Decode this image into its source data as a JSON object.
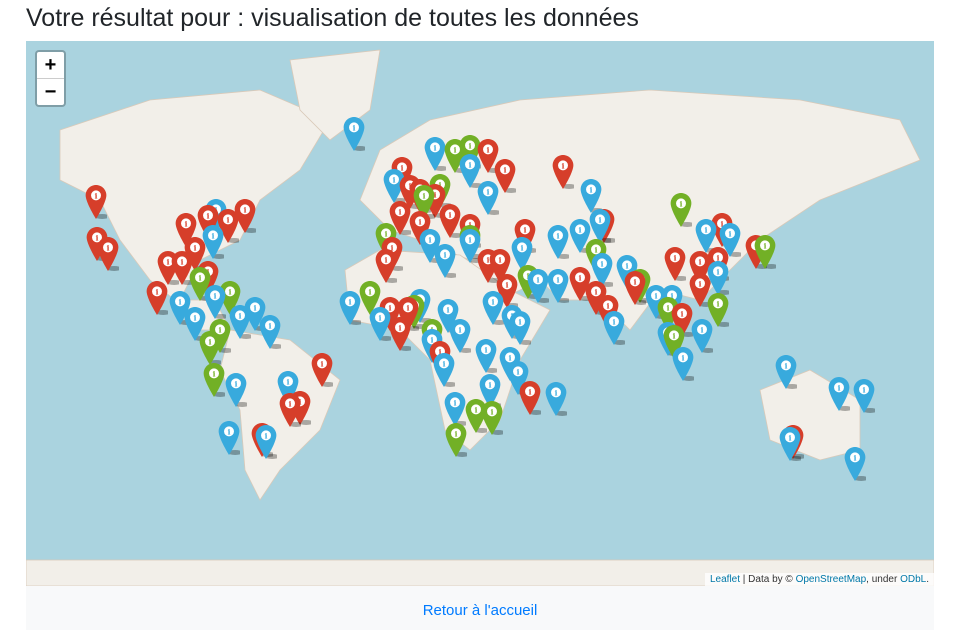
{
  "title": "Votre résultat pour : visualisation de toutes les données",
  "map": {
    "zoom_in": "+",
    "zoom_out": "−",
    "attribution": {
      "leaflet": "Leaflet",
      "sep": " | Data by © ",
      "osm": "OpenStreetMap",
      "under": ", under ",
      "odbl": "ODbL",
      "end": "."
    },
    "marker_colors": {
      "r": "#d63e2a",
      "b": "#38aadd",
      "g": "#72b026"
    },
    "marker_icon": "info-icon"
  },
  "footer": {
    "back_link": "Retour à l'accueil"
  }
}
